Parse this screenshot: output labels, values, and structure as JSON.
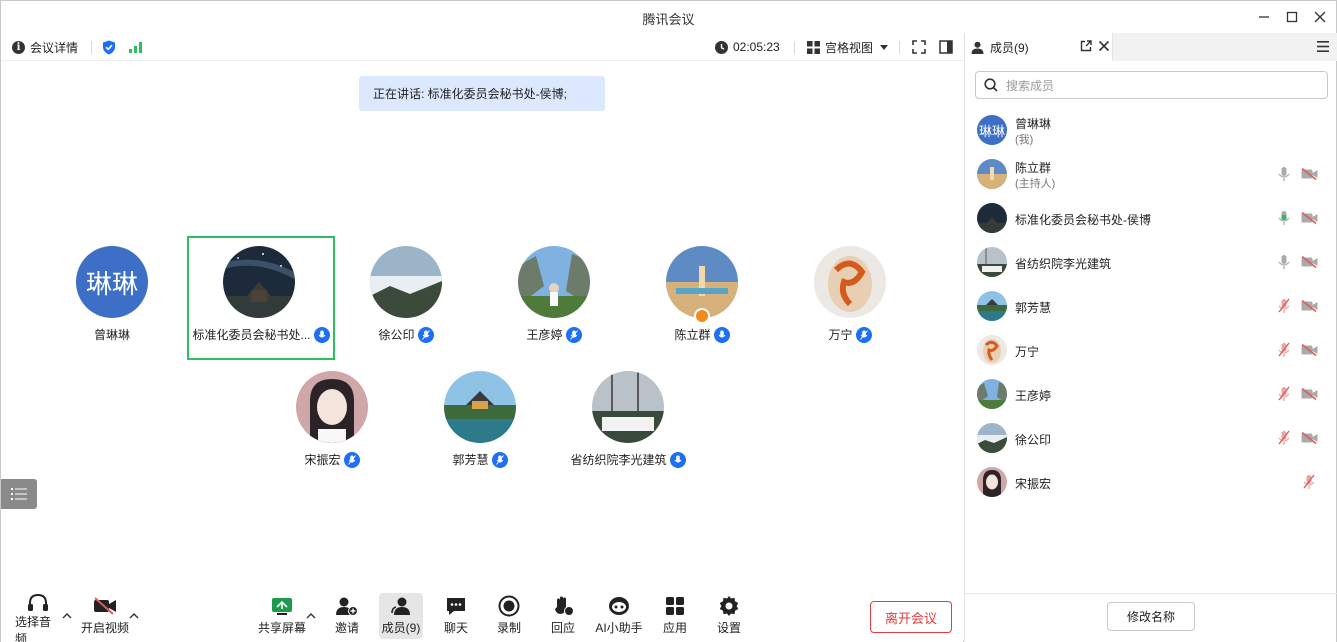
{
  "window": {
    "title": "腾讯会议"
  },
  "topbar": {
    "meeting_info": "会议详情",
    "timer": "02:05:23",
    "view_mode": "宫格视图"
  },
  "stage": {
    "speaking_banner": "正在讲话: 标准化委员会秘书处-侯博;",
    "participants": [
      {
        "name": "曾琳琳",
        "avatar_text": "琳琳"
      },
      {
        "name": "标准化委员会秘书处...",
        "speaking": true
      },
      {
        "name": "徐公印"
      },
      {
        "name": "王彦婷"
      },
      {
        "name": "陈立群",
        "host": true
      },
      {
        "name": "万宁"
      },
      {
        "name": "宋振宏"
      },
      {
        "name": "郭芳慧"
      },
      {
        "name": "省纺织院李光建筑"
      }
    ]
  },
  "bottombar": {
    "audio": "选择音频",
    "video": "开启视频",
    "share": "共享屏幕",
    "invite": "邀请",
    "members": "成员(9)",
    "chat": "聊天",
    "record": "录制",
    "react": "回应",
    "ai": "AI小助手",
    "apps": "应用",
    "settings": "设置",
    "leave": "离开会议"
  },
  "panel": {
    "tab_label": "成员(9)",
    "search_placeholder": "搜索成员",
    "members": [
      {
        "name": "曾琳琳",
        "sub": "(我)",
        "avatar_text": "琳琳"
      },
      {
        "name": "陈立群",
        "sub": "(主持人)"
      },
      {
        "name": "标准化委员会秘书处-侯博"
      },
      {
        "name": "省纺织院李光建筑"
      },
      {
        "name": "郭芳慧"
      },
      {
        "name": "万宁"
      },
      {
        "name": "王彦婷"
      },
      {
        "name": "徐公印"
      },
      {
        "name": "宋振宏"
      }
    ],
    "rename_button": "修改名称"
  },
  "colors": {
    "accent_blue": "#1e6ff5",
    "active_green": "#2bbf62",
    "leave_red": "#e23c3c",
    "muted_red": "#e05a5a"
  }
}
